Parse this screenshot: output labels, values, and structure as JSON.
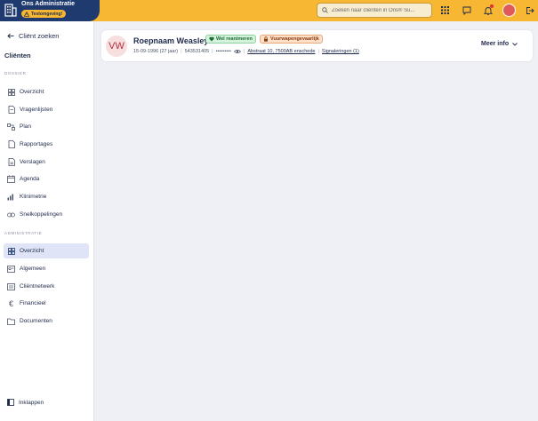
{
  "app": {
    "title": "Ons Administratie",
    "environment_badge": "Testomgeving!"
  },
  "topbar": {
    "search_placeholder": "Zoeken naar cliënten in Ons® Su..."
  },
  "sidebar": {
    "back_label": "Cliënt zoeken",
    "heading": "Cliënten",
    "sections": {
      "dossier": "DOSSIER",
      "administratie": "ADMINISTRATIE"
    },
    "dossier_items": [
      {
        "label": "Overzicht",
        "icon": "grid-icon"
      },
      {
        "label": "Vragenlijsten",
        "icon": "form-icon"
      },
      {
        "label": "Plan",
        "icon": "plan-icon"
      },
      {
        "label": "Rapportages",
        "icon": "report-icon"
      },
      {
        "label": "Verslagen",
        "icon": "document-icon"
      },
      {
        "label": "Agenda",
        "icon": "calendar-icon"
      },
      {
        "label": "Klinimetrie",
        "icon": "chart-icon"
      },
      {
        "label": "Snelkoppelingen",
        "icon": "link-icon"
      }
    ],
    "admin_items": [
      {
        "label": "Overzicht",
        "icon": "grid-icon",
        "active": true
      },
      {
        "label": "Algemeen",
        "icon": "id-card-icon"
      },
      {
        "label": "Cliëntnetwerk",
        "icon": "network-icon"
      },
      {
        "label": "Financieel",
        "icon": "euro-icon"
      },
      {
        "label": "Documenten",
        "icon": "folder-icon"
      }
    ],
    "collapse_label": "Inklappen"
  },
  "client": {
    "initials": "VW",
    "name": "Roepnaam Weasley",
    "tags": [
      {
        "label": "Wel reanimeren",
        "color": "#d5f2dc"
      },
      {
        "label": "Vuurwapengevaarlijk",
        "color": "#fde0c8"
      }
    ],
    "birth": "15-09-1996 (27 jaar)",
    "client_number": "543531405",
    "masked_bsn": "•••••••••",
    "address": "Abstraat 10, 7500AB enschede",
    "signals": "Signaleringen (1)",
    "more_info": "Meer info"
  },
  "colors": {
    "accent_yellow": "#f7b733",
    "brand_navy": "#1e3a6e",
    "active_nav": "#dfe5f7"
  }
}
